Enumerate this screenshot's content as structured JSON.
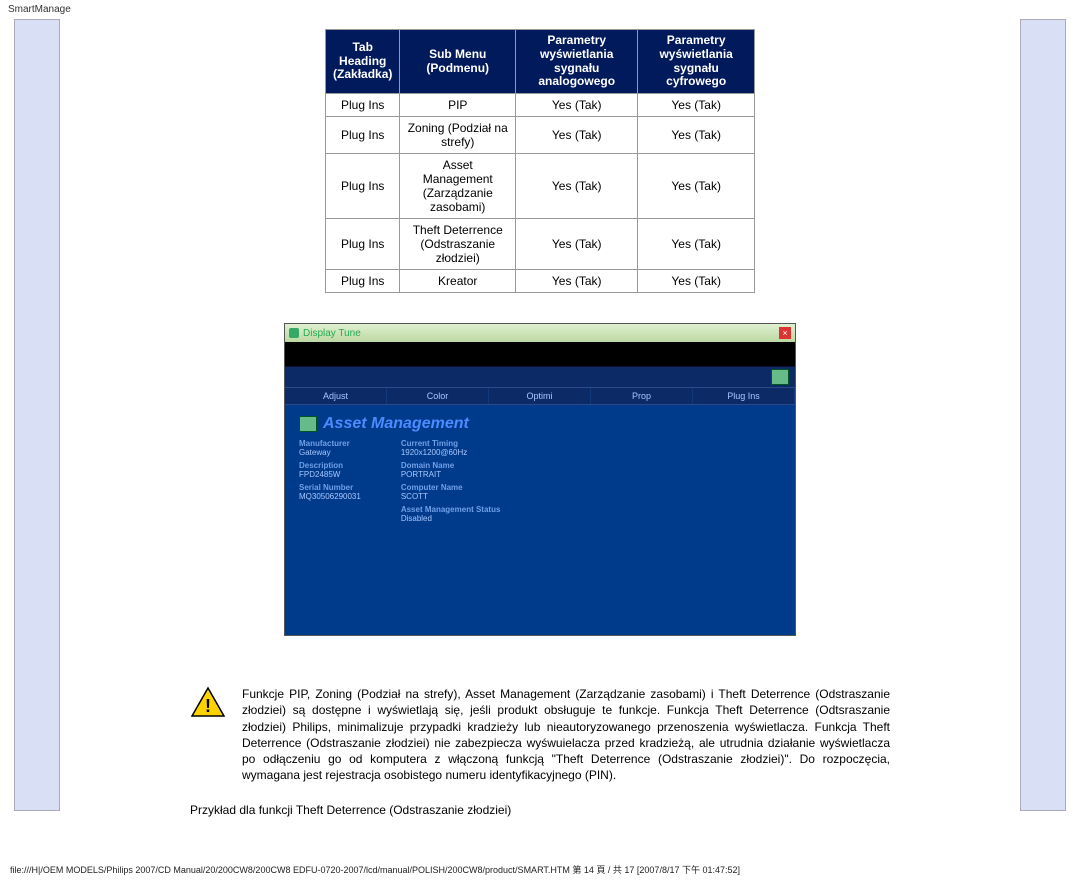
{
  "page_header": "SmartManage",
  "table": {
    "headers": [
      "Tab Heading (Zakładka)",
      "Sub Menu (Podmenu)",
      "Parametry wyświetlania sygnału analogowego",
      "Parametry wyświetlania sygnału cyfrowego"
    ],
    "rows": [
      [
        "Plug Ins",
        "PIP",
        "Yes (Tak)",
        "Yes (Tak)"
      ],
      [
        "Plug Ins",
        "Zoning (Podział na strefy)",
        "Yes (Tak)",
        "Yes (Tak)"
      ],
      [
        "Plug Ins",
        "Asset Management (Zarządzanie zasobami)",
        "Yes (Tak)",
        "Yes (Tak)"
      ],
      [
        "Plug Ins",
        "Theft Deterrence (Odstraszanie złodziei)",
        "Yes (Tak)",
        "Yes (Tak)"
      ],
      [
        "Plug Ins",
        "Kreator",
        "Yes (Tak)",
        "Yes (Tak)"
      ]
    ]
  },
  "shot": {
    "titlebar": "Display Tune",
    "tabs": [
      "Adjust",
      "Color",
      "Optimi",
      "Prop",
      "Plug Ins"
    ],
    "heading": "Asset Management",
    "left": {
      "l1": "Manufacturer",
      "v1": "Gateway",
      "l2": "Description",
      "v2": "FPD2485W",
      "l3": "Serial Number",
      "v3": "MQ30506290031"
    },
    "right": {
      "l1": "Current Timing",
      "v1": "1920x1200@60Hz",
      "l2": "Domain Name",
      "v2": "PORTRAIT",
      "l3": "Computer Name",
      "v3": "SCOTT",
      "l4": "Asset Management Status",
      "v4": "Disabled"
    }
  },
  "warning_text": "Funkcje PIP, Zoning (Podział na strefy), Asset Management (Zarządzanie zasobami) i Theft Deterrence (Odstraszanie złodziei) są dostępne i wyświetlają się, jeśli produkt obsługuje te funkcje. Funkcja Theft Deterrence (Odtsraszanie złodziei) Philips, minimalizuje przypadki kradzieży lub nieautoryzowanego przenoszenia wyświetlacza. Funkcja Theft Deterrence (Odstraszanie złodziei) nie zabezpiecza wyśwuielacza przed kradzieżą, ale utrudnia działanie wyświetlacza po odłączeniu go od komputera z włączoną funkcją \"Theft Deterrence (Odstraszanie złodziei)\". Do rozpoczęcia, wymagana jest rejestracja osobistego numeru identyfikacyjnego (PIN).",
  "example_line": "Przykład dla funkcji Theft Deterrence (Odstraszanie złodziei)",
  "footer": "file:///H|/OEM MODELS/Philips 2007/CD Manual/20/200CW8/200CW8 EDFU-0720-2007/lcd/manual/POLISH/200CW8/product/SMART.HTM 第 14 頁 / 共 17 [2007/8/17 下午 01:47:52]"
}
